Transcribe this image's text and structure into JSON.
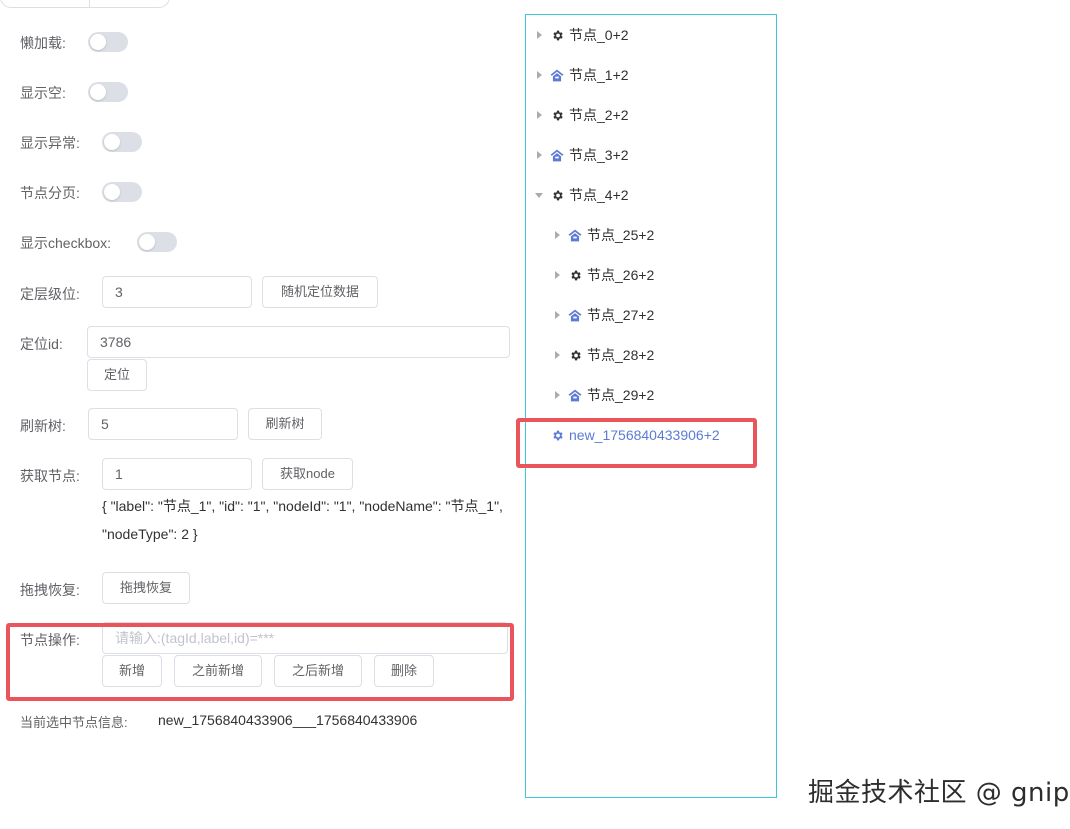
{
  "options": {
    "lazy_load": "懒加载:",
    "show_empty": "显示空:",
    "show_error": "显示异常:",
    "node_paging": "节点分页:",
    "show_checkbox": "显示checkbox:"
  },
  "locate_level": {
    "label": "定层级位:",
    "value": "3",
    "button": "随机定位数据"
  },
  "locate_id": {
    "label": "定位id:",
    "value": "3786",
    "button": "定位"
  },
  "refresh_tree": {
    "label": "刷新树:",
    "value": "5",
    "button": "刷新树"
  },
  "get_node": {
    "label": "获取节点:",
    "value": "1",
    "button": "获取node",
    "result": "{ \"label\": \"节点_1\", \"id\": \"1\", \"nodeId\": \"1\", \"nodeName\": \"节点_1\", \"nodeType\": 2 }"
  },
  "drag_restore": {
    "label": "拖拽恢复:",
    "button": "拖拽恢复"
  },
  "node_ops": {
    "label": "节点操作:",
    "placeholder": "请输入:(tagId,label,id)=***",
    "buttons": [
      "新增",
      "之前新增",
      "之后新增",
      "删除"
    ]
  },
  "selected_info": {
    "label": "当前选中节点信息:",
    "value": "new_1756840433906___1756840433906"
  },
  "tree": {
    "nodes": [
      {
        "label": "节点_0+2",
        "icon": "gear-icon",
        "expanded": false
      },
      {
        "label": "节点_1+2",
        "icon": "home-icon",
        "expanded": false
      },
      {
        "label": "节点_2+2",
        "icon": "gear-icon",
        "expanded": false
      },
      {
        "label": "节点_3+2",
        "icon": "home-icon",
        "expanded": false
      },
      {
        "label": "节点_4+2",
        "icon": "gear-icon",
        "expanded": true
      },
      {
        "label": "节点_25+2",
        "icon": "home-icon",
        "expanded": false
      },
      {
        "label": "节点_26+2",
        "icon": "gear-icon",
        "expanded": false
      },
      {
        "label": "节点_27+2",
        "icon": "home-icon",
        "expanded": false
      },
      {
        "label": "节点_28+2",
        "icon": "gear-icon",
        "expanded": false
      },
      {
        "label": "节点_29+2",
        "icon": "home-icon",
        "expanded": false
      },
      {
        "label": "new_1756840433906+2",
        "icon": "gear-icon",
        "expanded": false
      }
    ]
  },
  "watermark": "掘金技术社区 @ gnip",
  "colors": {
    "highlight_red": "#e9555b",
    "tree_border": "#3cc8d8",
    "node_blue": "#5b7bd5",
    "switch_off": "#dcdfe6"
  }
}
